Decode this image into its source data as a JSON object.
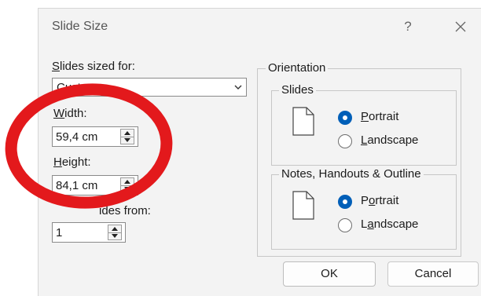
{
  "dialog": {
    "title": "Slide Size",
    "help_label": "?"
  },
  "left": {
    "slides_sized_for": {
      "label_mn": "S",
      "label_rest": "lides sized for:",
      "value": "Custom"
    },
    "width": {
      "label_mn": "W",
      "label_rest": "idth:",
      "value": "59,4 cm"
    },
    "height": {
      "label_mn": "H",
      "label_rest": "eight:",
      "value": "84,1 cm"
    },
    "number_slides_from": {
      "label_visible": "ides from:",
      "value": "1"
    }
  },
  "orientation": {
    "group_label": "Orientation",
    "slides": {
      "label": "Slides",
      "portrait": {
        "label_mn": "P",
        "label_rest": "ortrait",
        "selected": true
      },
      "landscape": {
        "label_mn": "L",
        "label_rest": "andscape",
        "selected": false
      }
    },
    "notes": {
      "label": "Notes, Handouts & Outline",
      "portrait": {
        "label_mn": "o",
        "label_pre": "P",
        "label_rest": "rtrait",
        "selected": true
      },
      "landscape": {
        "label_mn": "a",
        "label_pre": "L",
        "label_rest": "ndscape",
        "selected": false
      }
    }
  },
  "buttons": {
    "ok": "OK",
    "cancel": "Cancel"
  },
  "colors": {
    "accent": "#005fb8",
    "annotation": "#e3191c",
    "dialog_bg": "#f3f3f3"
  },
  "icons": [
    "close-icon",
    "dropdown-chevron-icon",
    "spin-up-icon",
    "spin-down-icon",
    "page-portrait-icon"
  ]
}
